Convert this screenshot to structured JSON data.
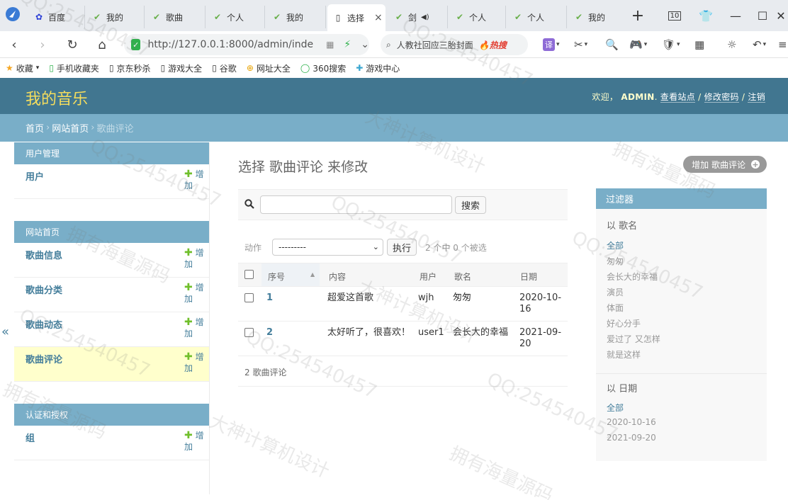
{
  "browser": {
    "tabs": [
      {
        "label": "百度",
        "icon": "baidu-paw-icon"
      },
      {
        "label": "我的",
        "icon": "django-icon"
      },
      {
        "label": "歌曲",
        "icon": "django-icon"
      },
      {
        "label": "个人",
        "icon": "django-icon"
      },
      {
        "label": "我的",
        "icon": "django-icon"
      },
      {
        "label": "选择",
        "icon": "page-icon"
      },
      {
        "label": "剑",
        "icon": "django-icon"
      },
      {
        "label": "个人",
        "icon": "django-icon"
      },
      {
        "label": "个人",
        "icon": "django-icon"
      },
      {
        "label": "我的",
        "icon": "django-icon"
      }
    ],
    "tab_count": "10",
    "url": "http://127.0.0.1:8000/admin/inde",
    "search_text": "人教社回应三胎封面",
    "hot_label": "热搜",
    "translate_label": "译",
    "bookmarks": [
      {
        "label": "收藏",
        "icon": "star-icon"
      },
      {
        "label": "手机收藏夹",
        "icon": "phone-icon"
      },
      {
        "label": "京东秒杀",
        "icon": "page-icon"
      },
      {
        "label": "游戏大全",
        "icon": "page-icon"
      },
      {
        "label": "谷歌",
        "icon": "page-icon"
      },
      {
        "label": "网址大全",
        "icon": "site-icon"
      },
      {
        "label": "360搜索",
        "icon": "search-360-icon"
      },
      {
        "label": "游戏中心",
        "icon": "game-icon"
      }
    ]
  },
  "header": {
    "branding": "我的音乐",
    "welcome": "欢迎，",
    "username": "ADMIN",
    "view_site": "查看站点",
    "change_password": "修改密码",
    "logout": "注销",
    "separator": "/"
  },
  "breadcrumbs": {
    "home": "首页",
    "app": "网站首页",
    "current": "歌曲评论",
    "separator": "›"
  },
  "sidebar": {
    "toggle": "«",
    "add_label": "增加",
    "modules": [
      {
        "caption": "用户管理",
        "models": [
          {
            "name": "用户"
          }
        ]
      },
      {
        "caption": "网站首页",
        "models": [
          {
            "name": "歌曲信息"
          },
          {
            "name": "歌曲分类"
          },
          {
            "name": "歌曲动态"
          },
          {
            "name": "歌曲评论"
          }
        ]
      },
      {
        "caption": "认证和授权",
        "models": [
          {
            "name": "组"
          }
        ]
      }
    ]
  },
  "content": {
    "title": "选择 歌曲评论 来修改",
    "add_button": "增加 歌曲评论",
    "search": {
      "value": "",
      "button": "搜索"
    },
    "actions": {
      "label": "动作",
      "selected_option": "---------",
      "go_button": "执行",
      "counter": "2 个中 0 个被选"
    },
    "table": {
      "columns": [
        "序号",
        "内容",
        "用户",
        "歌名",
        "日期"
      ],
      "rows": [
        {
          "id": "1",
          "content": "超爱这首歌",
          "user": "wjh",
          "song": "匆匆",
          "date": "2020-10-16"
        },
        {
          "id": "2",
          "content": "太好听了，很喜欢！",
          "user": "user1",
          "song": "会长大的幸福",
          "date": "2021-09-20"
        }
      ]
    },
    "paginator": "2 歌曲评论"
  },
  "filter": {
    "caption": "过滤器",
    "groups": [
      {
        "title": "以 歌名",
        "options": [
          "全部",
          "匆匆",
          "会长大的幸福",
          "演员",
          "体面",
          "好心分手",
          "爱过了 又怎样",
          "就是这样"
        ]
      },
      {
        "title": "以 日期",
        "options": [
          "全部",
          "2020-10-16",
          "2021-09-20"
        ]
      }
    ]
  },
  "watermarks": [
    "QQ:254540457",
    "大神计算机设计",
    "拥有海量源码"
  ],
  "colors": {
    "header_bg": "#417690",
    "branding": "#f5dd5d",
    "breadcrumb_bg": "#79aec8",
    "link": "#447e9b",
    "addlink_green": "#70bf2b",
    "current_row": "#ffffcc"
  }
}
